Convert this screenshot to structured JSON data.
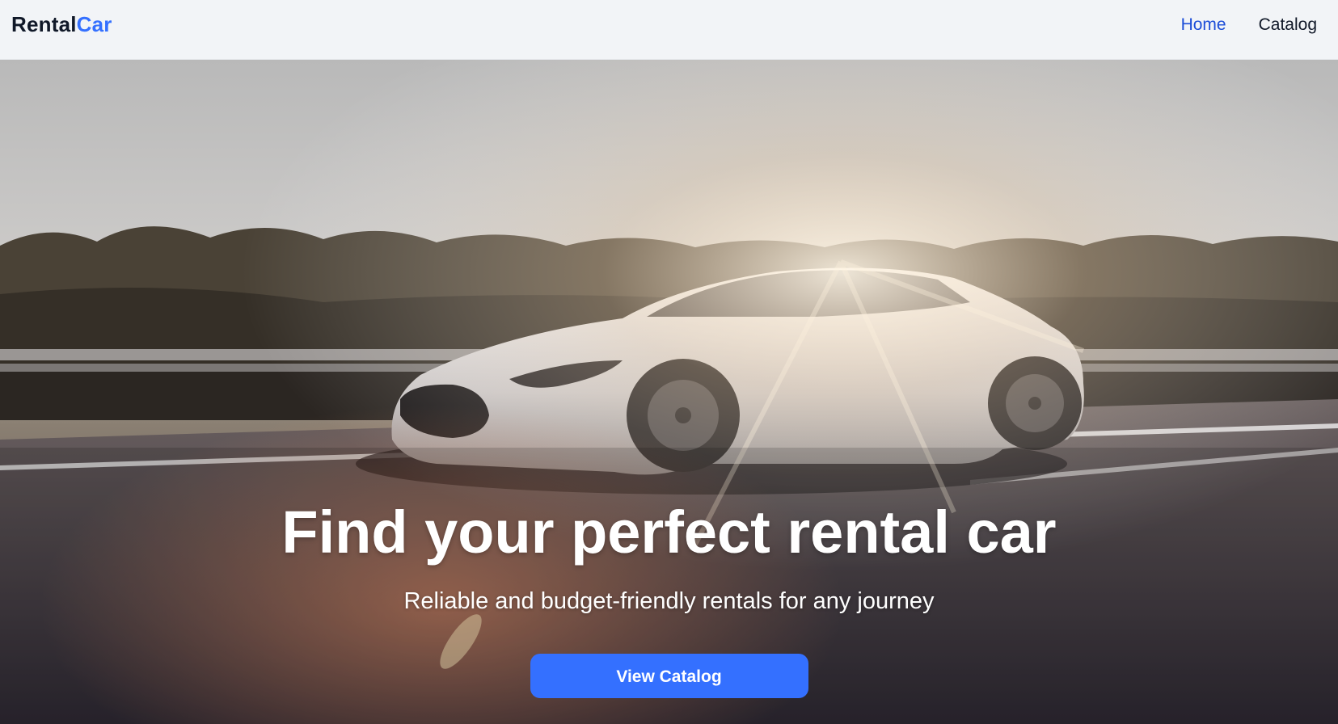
{
  "brand": {
    "name_part1": "Rental",
    "name_part2": "Car"
  },
  "nav": {
    "items": [
      {
        "label": "Home",
        "active": true
      },
      {
        "label": "Catalog",
        "active": false
      }
    ]
  },
  "hero": {
    "title": "Find your perfect rental car",
    "subtitle": "Reliable and budget-friendly rentals for any journey",
    "cta_label": "View Catalog",
    "background_image": "white-sports-car-on-highway-at-sunset"
  },
  "colors": {
    "accent": "#3470ff",
    "active_nav": "#1d4ed8",
    "header_bg": "#f2f4f7",
    "text_dark": "#101828"
  }
}
